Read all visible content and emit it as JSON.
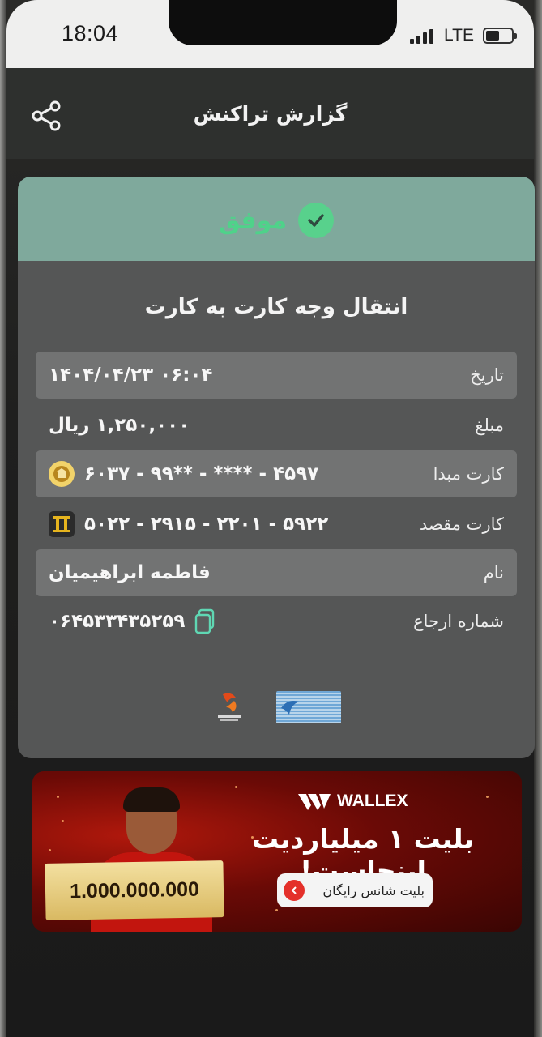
{
  "status_bar": {
    "time": "18:04",
    "network": "LTE"
  },
  "header": {
    "title": "گزارش تراکنش",
    "share_icon": "share-icon"
  },
  "receipt": {
    "status": "موفق",
    "status_color": "#4fd28a",
    "transaction_type": "انتقال وجه کارت به کارت",
    "rows": {
      "date": {
        "label": "تاریخ",
        "value": "۱۴۰۴/۰۴/۲۳ ۰۶:۰۴"
      },
      "amount": {
        "label": "مبلغ",
        "value": "۱,۲۵۰,۰۰۰ ریال"
      },
      "source_card": {
        "label": "کارت مبدا",
        "value": "۶۰۳۷ - ۹۹** - **** - ۴۵۹۷",
        "bank_icon": "bank-melli-icon"
      },
      "dest_card": {
        "label": "کارت مقصد",
        "value": "۵۰۲۲ - ۲۹۱۵ - ۲۲۰۱ - ۵۹۲۲",
        "bank_icon": "bank-pasargad-icon"
      },
      "name": {
        "label": "نام",
        "value": "فاطمه ابراهیمیان"
      },
      "reference": {
        "label": "شماره ارجاع",
        "value": "۰۶۴۵۳۳۴۳۵۲۵۹",
        "copy_icon": "copy-icon"
      }
    },
    "footer_logos": [
      "shaparak-logo",
      "provider-logo"
    ]
  },
  "ad": {
    "brand": "WALLEX",
    "headline": "بلیت ۱ میلیاردیت اینجاست!",
    "amount": "1.000.000.000",
    "cta": "بلیت شانس رایگان"
  }
}
